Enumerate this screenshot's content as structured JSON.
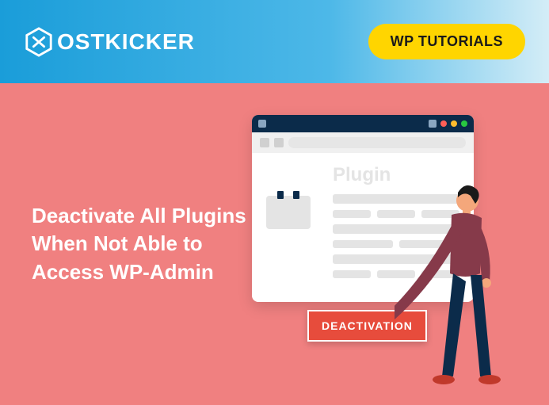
{
  "header": {
    "logo_text": "OSTKICKER",
    "tag": "WP TUTORIALS"
  },
  "hero": {
    "title": "Deactivate All Plugins When Not Able to Access WP-Admin"
  },
  "illustration": {
    "panel_title": "Plugin",
    "button_label": "DEACTIVATION"
  }
}
